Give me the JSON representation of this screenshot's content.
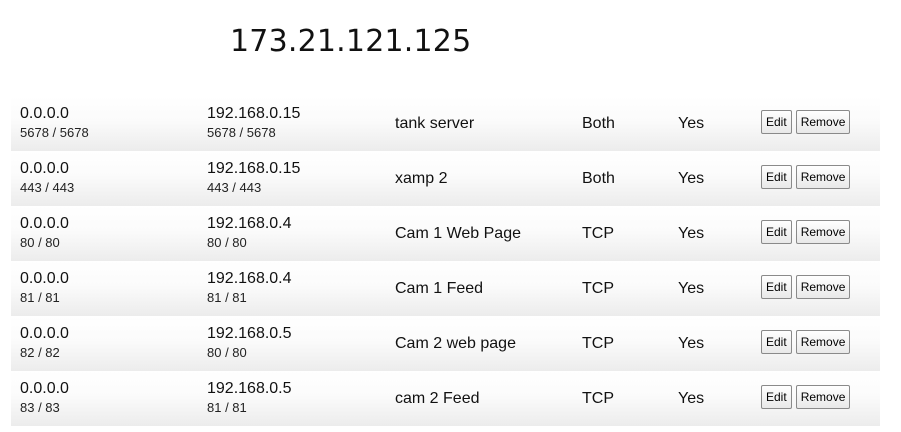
{
  "header": {
    "public_ip": "173.21.121.125"
  },
  "rules": [
    {
      "external_ip": "0.0.0.0",
      "external_ports": "5678 / 5678",
      "internal_ip": "192.168.0.15",
      "internal_ports": "5678 / 5678",
      "name": "tank server",
      "protocol": "Both",
      "enabled": "Yes",
      "edit_label": "Edit",
      "remove_label": "Remove"
    },
    {
      "external_ip": "0.0.0.0",
      "external_ports": "443 / 443",
      "internal_ip": "192.168.0.15",
      "internal_ports": "443 / 443",
      "name": "xamp 2",
      "protocol": "Both",
      "enabled": "Yes",
      "edit_label": "Edit",
      "remove_label": "Remove"
    },
    {
      "external_ip": "0.0.0.0",
      "external_ports": "80 / 80",
      "internal_ip": "192.168.0.4",
      "internal_ports": "80 / 80",
      "name": "Cam 1 Web Page",
      "protocol": "TCP",
      "enabled": "Yes",
      "edit_label": "Edit",
      "remove_label": "Remove"
    },
    {
      "external_ip": "0.0.0.0",
      "external_ports": "81 / 81",
      "internal_ip": "192.168.0.4",
      "internal_ports": "81 / 81",
      "name": "Cam 1 Feed",
      "protocol": "TCP",
      "enabled": "Yes",
      "edit_label": "Edit",
      "remove_label": "Remove"
    },
    {
      "external_ip": "0.0.0.0",
      "external_ports": "82 / 82",
      "internal_ip": "192.168.0.5",
      "internal_ports": "80 / 80",
      "name": "Cam 2 web page",
      "protocol": "TCP",
      "enabled": "Yes",
      "edit_label": "Edit",
      "remove_label": "Remove"
    },
    {
      "external_ip": "0.0.0.0",
      "external_ports": "83 / 83",
      "internal_ip": "192.168.0.5",
      "internal_ports": "81 / 81",
      "name": "cam 2 Feed",
      "protocol": "TCP",
      "enabled": "Yes",
      "edit_label": "Edit",
      "remove_label": "Remove"
    }
  ]
}
